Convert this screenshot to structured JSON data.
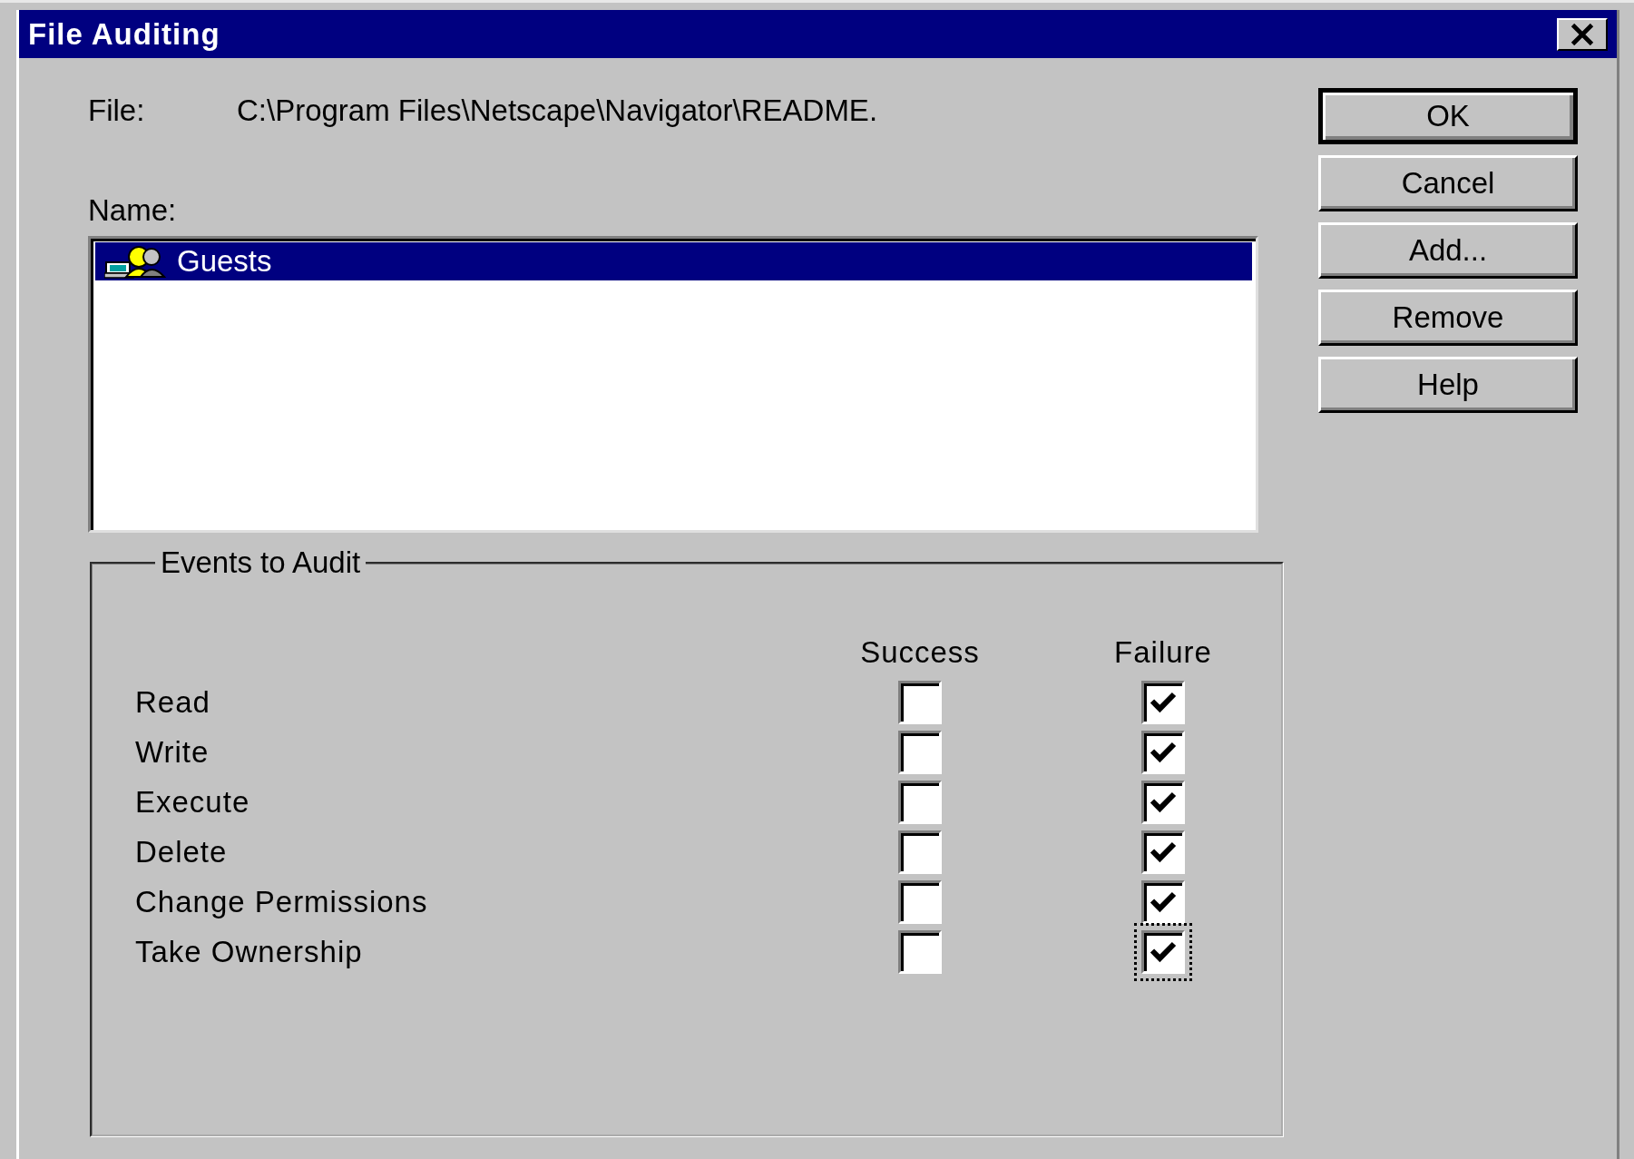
{
  "window": {
    "title": "File Auditing"
  },
  "file": {
    "label": "File:",
    "path": "C:\\Program Files\\Netscape\\Navigator\\README."
  },
  "name": {
    "label": "Name:",
    "items": [
      {
        "label": "Guests",
        "selected": true
      }
    ]
  },
  "events": {
    "title": "Events to Audit",
    "columns": [
      "Success",
      "Failure"
    ],
    "rows": [
      {
        "label": "Read",
        "success": false,
        "failure": true,
        "focused": false
      },
      {
        "label": "Write",
        "success": false,
        "failure": true,
        "focused": false
      },
      {
        "label": "Execute",
        "success": false,
        "failure": true,
        "focused": false
      },
      {
        "label": "Delete",
        "success": false,
        "failure": true,
        "focused": false
      },
      {
        "label": "Change Permissions",
        "success": false,
        "failure": true,
        "focused": false
      },
      {
        "label": "Take Ownership",
        "success": false,
        "failure": true,
        "focused": true
      }
    ]
  },
  "buttons": [
    {
      "label": "OK",
      "default": true
    },
    {
      "label": "Cancel",
      "default": false
    },
    {
      "label": "Add...",
      "default": false
    },
    {
      "label": "Remove",
      "default": false
    },
    {
      "label": "Help",
      "default": false
    }
  ]
}
